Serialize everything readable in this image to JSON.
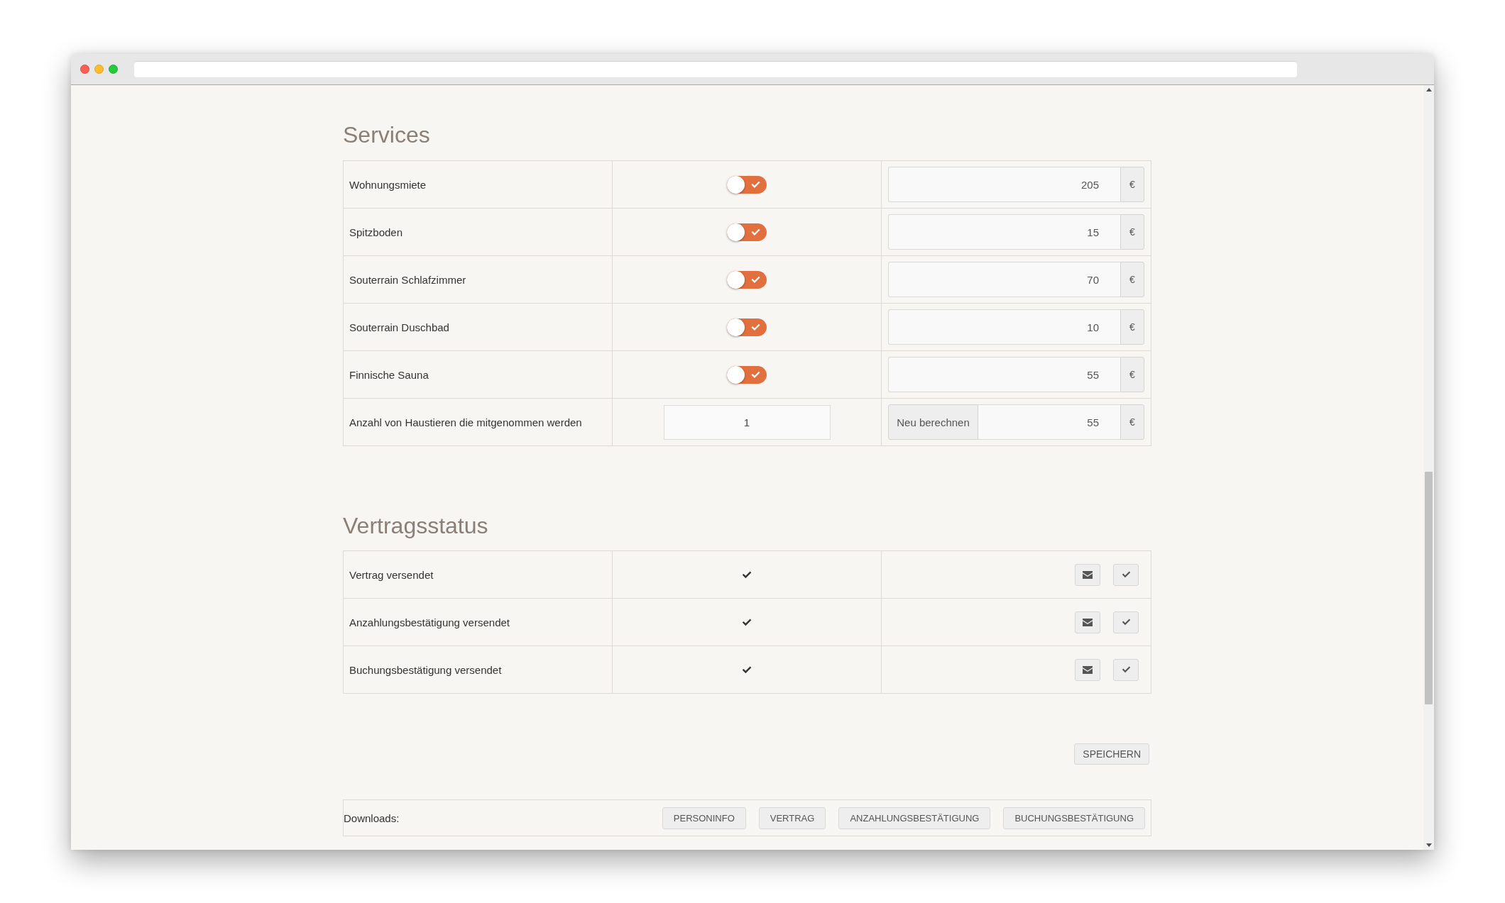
{
  "services": {
    "title": "Services",
    "rows": [
      {
        "kind": "toggle",
        "label": "Wohnungsmiete",
        "checked": true,
        "amount": "205",
        "currency": "€"
      },
      {
        "kind": "toggle",
        "label": "Spitzboden",
        "checked": true,
        "amount": "15",
        "currency": "€"
      },
      {
        "kind": "toggle",
        "label": "Souterrain Schlafzimmer",
        "checked": true,
        "amount": "70",
        "currency": "€"
      },
      {
        "kind": "toggle",
        "label": "Souterrain Duschbad",
        "checked": true,
        "amount": "10",
        "currency": "€"
      },
      {
        "kind": "toggle",
        "label": "Finnische Sauna",
        "checked": true,
        "amount": "55",
        "currency": "€"
      },
      {
        "kind": "quantity",
        "label": "Anzahl von Haustieren die mitgenommen werden",
        "quantity": "1",
        "action": "Neu berechnen",
        "amount": "55",
        "currency": "€"
      }
    ]
  },
  "contract_status": {
    "title": "Vertragsstatus",
    "rows": [
      {
        "label": "Vertrag versendet",
        "sent": true
      },
      {
        "label": "Anzahlungsbestätigung versendet",
        "sent": true
      },
      {
        "label": "Buchungsbestätigung versendet",
        "sent": true
      }
    ]
  },
  "save_button": "SPEICHERN",
  "downloads": {
    "label": "Downloads:",
    "buttons": [
      "PERSONINFO",
      "VERTRAG",
      "ANZAHLUNGSBESTÄTIGUNG",
      "BUCHUNGSBESTÄTIGUNG"
    ]
  }
}
